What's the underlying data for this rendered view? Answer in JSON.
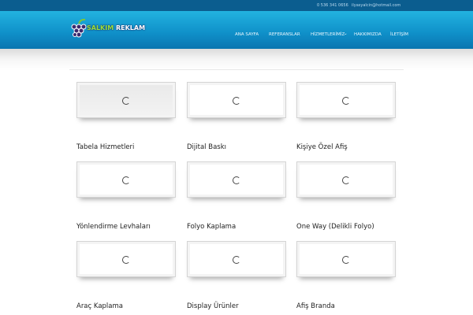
{
  "topbar": {
    "phone": "0 536 341 0656",
    "email": "ilyasyalcin@hotmail.com"
  },
  "logo": {
    "brand_a": "SALKIM",
    "brand_b": "REKLAM"
  },
  "nav": [
    "ANA SAYFA",
    "REFERANSLAR",
    "HİZMETLERİMİZ",
    "HAKKIMIZDA",
    "İLETİŞİM"
  ],
  "services": [
    "Tabela Hizmetleri",
    "Dijital Baskı",
    "Kişiye Özel Afiş",
    "Yönlendirme Levhaları",
    "Folyo Kaplama",
    "One Way (Delikli Folyo)",
    "Araç Kaplama",
    "Display Ürünler",
    "Afiş Branda"
  ],
  "colors": {
    "topbar": "#0b5d8f",
    "header": "#1aa3d6"
  }
}
